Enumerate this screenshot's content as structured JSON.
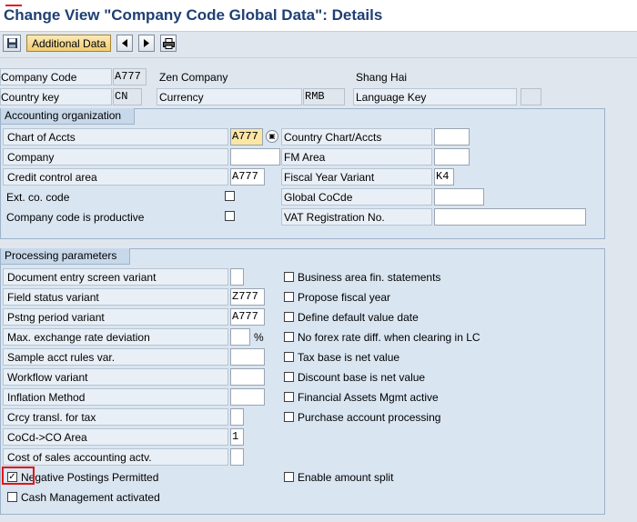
{
  "title": "Change View \"Company Code Global Data\": Details",
  "toolbar": {
    "additional_data": "Additional Data",
    "icons": [
      "save-icon",
      "prev-entry-icon",
      "next-entry-icon",
      "print-icon"
    ]
  },
  "header": {
    "company_code_label": "Company Code",
    "company_code": "A777",
    "company_name": "Zen Company",
    "city": "Shang Hai",
    "country_key_label": "Country key",
    "country_key": "CN",
    "currency_label": "Currency",
    "currency": "RMB",
    "language_key_label": "Language Key",
    "language_key": ""
  },
  "accounting": {
    "title": "Accounting organization",
    "chart_of_accts_label": "Chart of Accts",
    "chart_of_accts": "A777",
    "company_label": "Company",
    "company": "",
    "credit_control_label": "Credit control area",
    "credit_control": "A777",
    "ext_co_code_label": "Ext. co. code",
    "productive_label": "Company code is productive",
    "country_chart_label": "Country Chart/Accts",
    "country_chart": "",
    "fm_area_label": "FM Area",
    "fm_area": "",
    "fiscal_year_label": "Fiscal Year Variant",
    "fiscal_year": "K4",
    "global_cocd_label": "Global CoCde",
    "global_cocd": "",
    "vat_label": "VAT Registration No.",
    "vat": ""
  },
  "processing": {
    "title": "Processing parameters",
    "doc_entry_label": "Document entry screen variant",
    "doc_entry": "",
    "field_status_label": "Field status variant",
    "field_status": "Z777",
    "pstng_period_label": "Pstng period variant",
    "pstng_period": "A777",
    "max_exch_label": "Max. exchange rate deviation",
    "max_exch": "",
    "percent": "%",
    "sample_acct_label": "Sample acct rules var.",
    "sample_acct": "",
    "workflow_label": "Workflow variant",
    "workflow": "",
    "inflation_label": "Inflation Method",
    "inflation": "",
    "crcy_transl_label": "Crcy transl. for tax",
    "crcy_transl": "",
    "cocd_co_label": "CoCd->CO Area",
    "cocd_co": "1",
    "cost_sales_label": "Cost of sales accounting actv.",
    "cost_sales": "",
    "neg_postings_label": "Negative Postings Permitted",
    "cash_mgmt_label": "Cash Management activated",
    "business_area_label": "Business area fin. statements",
    "propose_fy_label": "Propose fiscal year",
    "default_value_date_label": "Define default value date",
    "no_forex_label": "No forex rate diff. when clearing in LC",
    "tax_base_label": "Tax base is net value",
    "discount_base_label": "Discount base is net value",
    "fin_assets_label": "Financial Assets Mgmt active",
    "purchase_acct_label": "Purchase account processing",
    "enable_split_label": "Enable amount split"
  },
  "checked_mark": "✓"
}
